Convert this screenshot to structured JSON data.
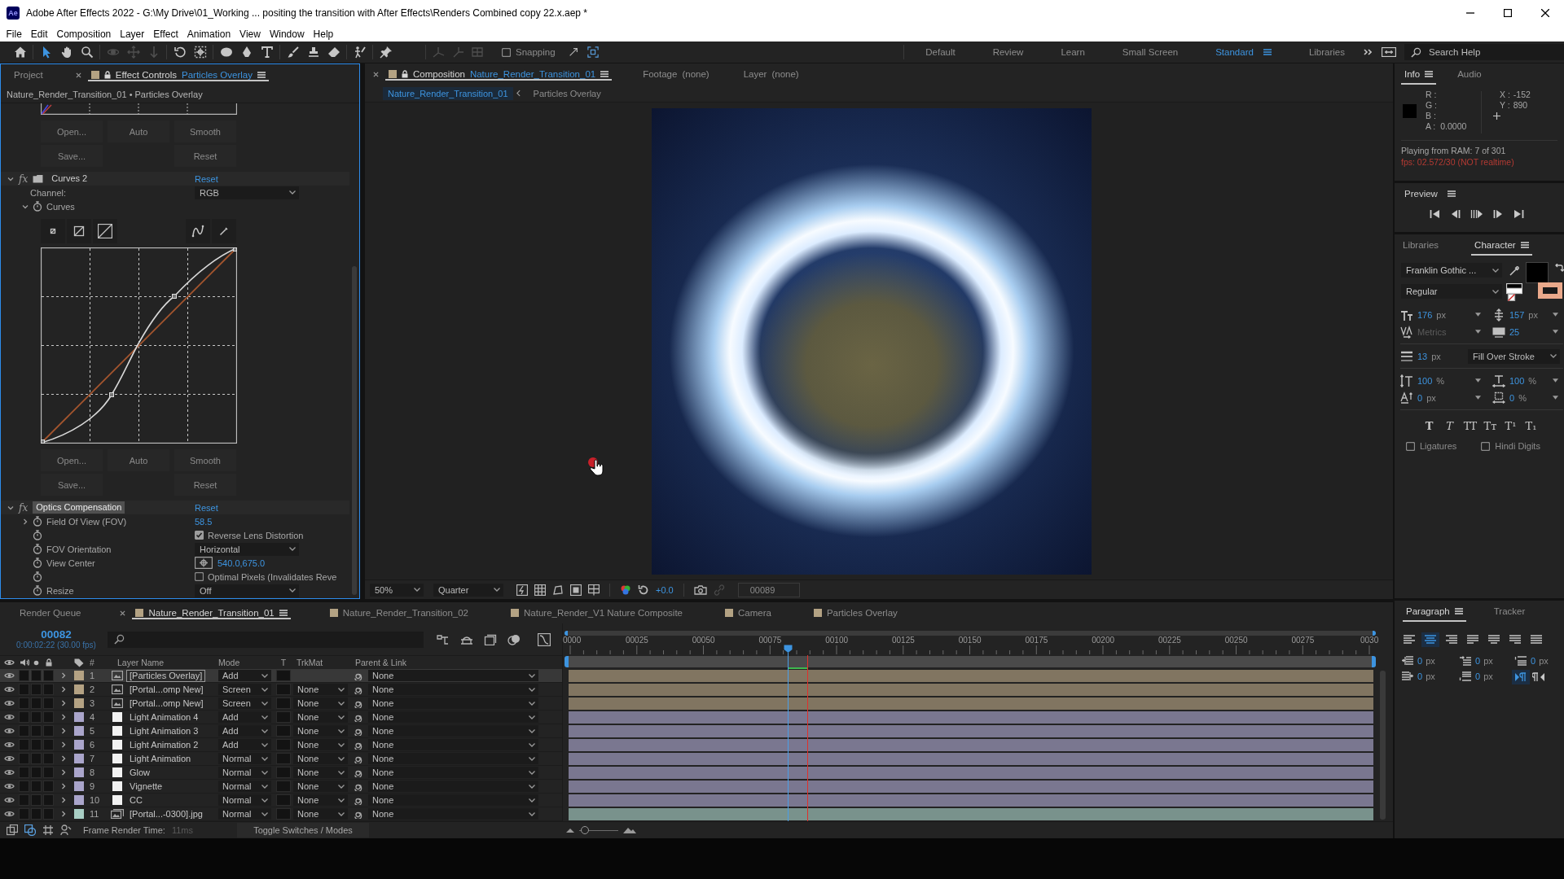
{
  "window": {
    "app_logo": "Ae",
    "title": "Adobe After Effects 2022 - G:\\My Drive\\01_Working ... positing the transition with After Effects\\Renders Combined copy 22.x.aep *"
  },
  "menu": [
    "File",
    "Edit",
    "Composition",
    "Layer",
    "Effect",
    "Animation",
    "View",
    "Window",
    "Help"
  ],
  "toolbar": {
    "tools": [
      {
        "kind": "home",
        "selected": false,
        "disabled": false
      },
      {
        "kind": "selection",
        "selected": true,
        "disabled": false
      },
      {
        "kind": "hand",
        "selected": false,
        "disabled": false
      },
      {
        "kind": "zoom",
        "selected": false,
        "disabled": false
      },
      {
        "kind": "orbit",
        "selected": false,
        "disabled": true
      },
      {
        "kind": "pan",
        "selected": false,
        "disabled": true
      },
      {
        "kind": "dolly",
        "selected": false,
        "disabled": true
      },
      {
        "kind": "rotate",
        "selected": false,
        "disabled": false
      },
      {
        "kind": "anchor",
        "selected": false,
        "disabled": false
      },
      {
        "kind": "ellipse",
        "selected": false,
        "disabled": false
      },
      {
        "kind": "pen",
        "selected": false,
        "disabled": false
      },
      {
        "kind": "type",
        "selected": false,
        "disabled": false
      },
      {
        "kind": "brush",
        "selected": false,
        "disabled": false
      },
      {
        "kind": "stamp",
        "selected": false,
        "disabled": false
      },
      {
        "kind": "eraser",
        "selected": false,
        "disabled": false
      },
      {
        "kind": "roto",
        "selected": false,
        "disabled": false
      },
      {
        "kind": "pin",
        "selected": false,
        "disabled": false
      }
    ],
    "axis_modes": [
      {
        "kind": "local",
        "disabled": true
      },
      {
        "kind": "world",
        "disabled": true
      },
      {
        "kind": "view",
        "disabled": true
      }
    ],
    "snapping": {
      "label": "Snapping",
      "checked": false
    },
    "workspaces": [
      {
        "label": "Default",
        "selected": false
      },
      {
        "label": "Review",
        "selected": false
      },
      {
        "label": "Learn",
        "selected": false
      },
      {
        "label": "Small Screen",
        "selected": false
      },
      {
        "label": "Standard",
        "selected": true
      },
      {
        "label": "Libraries",
        "selected": false
      }
    ],
    "search": {
      "placeholder": "Search Help"
    }
  },
  "effect_controls": {
    "tabs": [
      {
        "label": "Project",
        "selected": false
      },
      {
        "label": "Effect Controls",
        "subject": "Particles Overlay",
        "selected": true
      }
    ],
    "subtitle": "Nature_Render_Transition_01 • Particles Overlay",
    "previous_effect_buttons": {
      "top": [
        "Open...",
        "Auto",
        "Smooth"
      ],
      "bottom": [
        "Save...",
        "Reset"
      ]
    },
    "effects": [
      {
        "kind": "curves",
        "switch_label": "fx",
        "name": "Curves 2",
        "selected": false,
        "expanded": true,
        "reset": "Reset",
        "channel_label": "Channel:",
        "channel": "RGB",
        "property": "Curves",
        "property_expanded": true,
        "buttons": {
          "top": [
            "Open...",
            "Auto",
            "Smooth"
          ],
          "bottom": [
            "Save...",
            "Reset"
          ]
        }
      },
      {
        "kind": "optics",
        "switch_label": "fx",
        "name": "Optics Compensation",
        "selected": true,
        "expanded": true,
        "reset": "Reset",
        "properties": [
          {
            "kind": "value",
            "label": "Field Of View (FOV)",
            "value": "58.5",
            "expanded": false
          },
          {
            "kind": "checkbox",
            "label": "Reverse Lens Distortion",
            "checked": true
          },
          {
            "kind": "dropdown",
            "label": "FOV Orientation",
            "value": "Horizontal"
          },
          {
            "kind": "point",
            "label": "View Center",
            "value": "540.0,675.0"
          },
          {
            "kind": "checkbox",
            "label": "Optimal Pixels (Invalidates Reve",
            "checked": false
          },
          {
            "kind": "dropdown",
            "label": "Resize",
            "value": "Off"
          }
        ]
      }
    ]
  },
  "composition": {
    "tabs": [
      {
        "label": "Composition",
        "subject": "Nature_Render_Transition_01",
        "selected": true
      },
      {
        "label": "Footage",
        "subject": "(none)",
        "selected": false
      },
      {
        "label": "Layer",
        "subject": "(none)",
        "selected": false
      }
    ],
    "breadcrumbs": [
      {
        "label": "Nature_Render_Transition_01",
        "selected": true
      },
      {
        "label": "Particles Overlay",
        "selected": false
      }
    ],
    "viewer": {
      "magnification": "50%",
      "resolution": "Quarter",
      "exposure": "+0.0",
      "current_frame": "00089"
    }
  },
  "info": {
    "tabs": [
      {
        "label": "Info",
        "selected": true
      },
      {
        "label": "Audio",
        "selected": false
      }
    ],
    "channels": [
      "R :",
      "G :",
      "B :"
    ],
    "alpha": {
      "label": "A :",
      "value": "0.0000"
    },
    "position": [
      {
        "label": "X :",
        "value": "-152"
      },
      {
        "label": "Y :",
        "value": "890"
      }
    ],
    "status": "Playing from RAM: 7 of 301",
    "warning": "fps: 02.572/30 (NOT realtime)"
  },
  "preview": {
    "title": "Preview"
  },
  "character": {
    "tabs": [
      {
        "label": "Libraries",
        "selected": false
      },
      {
        "label": "Character",
        "selected": true
      }
    ],
    "font_family": "Franklin Gothic ...",
    "font_style": "Regular",
    "swatches": [
      {
        "kind": "fill",
        "color": "#000000"
      },
      {
        "kind": "stroke",
        "color": "#eaa98b"
      }
    ],
    "metrics": [
      {
        "kind": "font-size",
        "value": "176",
        "unit": "px",
        "disabled": false
      },
      {
        "kind": "leading",
        "value": "157",
        "unit": "px",
        "disabled": false
      },
      {
        "kind": "kerning",
        "value": "Metrics",
        "disabled": true
      },
      {
        "kind": "tracking",
        "value": "25",
        "disabled": false
      },
      {
        "kind": "stroke-width",
        "value": "13",
        "unit": "px",
        "disabled": false
      },
      {
        "kind": "stroke-order",
        "value": "Fill Over Stroke",
        "disabled": false
      },
      {
        "kind": "vertical-scale",
        "value": "100",
        "unit": "%",
        "disabled": false
      },
      {
        "kind": "horizontal-scale",
        "value": "100",
        "unit": "%",
        "disabled": false
      },
      {
        "kind": "baseline-shift",
        "value": "0",
        "unit": "px",
        "disabled": false
      },
      {
        "kind": "tsume",
        "value": "0",
        "unit": "%",
        "disabled": false
      }
    ],
    "type_styles": [
      {
        "kind": "bold",
        "label": "T"
      },
      {
        "kind": "italic",
        "label": "T"
      },
      {
        "kind": "caps",
        "label": "TT"
      },
      {
        "kind": "smallcaps",
        "label": "Tᴛ"
      },
      {
        "kind": "superscript",
        "label": "T¹"
      },
      {
        "kind": "subscript",
        "label": "T₁"
      }
    ],
    "options": [
      {
        "label": "Ligatures",
        "checked": false
      },
      {
        "label": "Hindi Digits",
        "checked": false
      }
    ]
  },
  "paragraph": {
    "tabs": [
      {
        "label": "Paragraph",
        "selected": true
      },
      {
        "label": "Tracker",
        "selected": false
      }
    ],
    "alignment": [
      {
        "kind": "left",
        "selected": false
      },
      {
        "kind": "center",
        "selected": true
      },
      {
        "kind": "right",
        "selected": false
      },
      {
        "kind": "justify-left",
        "selected": false
      },
      {
        "kind": "justify-center",
        "selected": false
      },
      {
        "kind": "justify-right",
        "selected": false
      },
      {
        "kind": "justify-all",
        "selected": false
      }
    ],
    "spacing": [
      {
        "kind": "indent-left",
        "value": "0",
        "unit": "px"
      },
      {
        "kind": "indent-first-line",
        "value": "0",
        "unit": "px"
      },
      {
        "kind": "space-before",
        "value": "0",
        "unit": "px"
      },
      {
        "kind": "indent-right",
        "value": "0",
        "unit": "px"
      },
      {
        "kind": "space-after",
        "value": "0",
        "unit": "px"
      }
    ],
    "direction": [
      {
        "kind": "left-to-right",
        "selected": true
      },
      {
        "kind": "right-to-left",
        "selected": false
      }
    ]
  },
  "timeline": {
    "tabs": [
      {
        "kind": "queue",
        "label": "Render Queue",
        "selected": false
      },
      {
        "kind": "comp",
        "label": "Nature_Render_Transition_01",
        "selected": true
      },
      {
        "kind": "comp",
        "label": "Nature_Render_Transition_02",
        "selected": false
      },
      {
        "kind": "comp",
        "label": "Nature_Render_V1 Nature Composite",
        "selected": false
      },
      {
        "kind": "comp",
        "label": "Camera",
        "selected": false
      },
      {
        "kind": "comp",
        "label": "Particles Overlay",
        "selected": false
      }
    ],
    "timecode": "00082",
    "timecode_detail": "0:00:02:22 (30.00 fps)",
    "columns": [
      "#",
      "Layer Name",
      "Mode",
      "T",
      "TrkMat",
      "Parent & Link"
    ],
    "layers": [
      {
        "number": "1",
        "name": "[Particles Overlay]",
        "kind": "precomp",
        "color": "#b4a283",
        "mode": "Add",
        "parent": "None",
        "visible": true,
        "expanded": false,
        "selected": true
      },
      {
        "number": "2",
        "name": "[Portal...omp New]",
        "kind": "precomp",
        "color": "#b4a283",
        "mode": "Screen",
        "trkmat": "None",
        "parent": "None",
        "visible": true,
        "expanded": false,
        "selected": false
      },
      {
        "number": "3",
        "name": "[Portal...omp New]",
        "kind": "precomp",
        "color": "#b4a283",
        "mode": "Screen",
        "trkmat": "None",
        "parent": "None",
        "visible": true,
        "expanded": false,
        "selected": false
      },
      {
        "number": "4",
        "name": "Light Animation 4",
        "kind": "solid",
        "color": "#aaa5cb",
        "mode": "Add",
        "trkmat": "None",
        "parent": "None",
        "visible": true,
        "expanded": false,
        "selected": false
      },
      {
        "number": "5",
        "name": "Light Animation 3",
        "kind": "solid",
        "color": "#aaa5cb",
        "mode": "Add",
        "trkmat": "None",
        "parent": "None",
        "visible": true,
        "expanded": false,
        "selected": false
      },
      {
        "number": "6",
        "name": "Light Animation 2",
        "kind": "solid",
        "color": "#aaa5cb",
        "mode": "Add",
        "trkmat": "None",
        "parent": "None",
        "visible": true,
        "expanded": false,
        "selected": false
      },
      {
        "number": "7",
        "name": "Light Animation",
        "kind": "solid",
        "color": "#aaa5cb",
        "mode": "Normal",
        "trkmat": "None",
        "parent": "None",
        "visible": true,
        "expanded": false,
        "selected": false
      },
      {
        "number": "8",
        "name": "Glow",
        "kind": "solid",
        "color": "#aaa5cb",
        "mode": "Normal",
        "trkmat": "None",
        "parent": "None",
        "visible": true,
        "expanded": false,
        "selected": false
      },
      {
        "number": "9",
        "name": "Vignette",
        "kind": "solid",
        "color": "#aaa5cb",
        "mode": "Normal",
        "trkmat": "None",
        "parent": "None",
        "visible": true,
        "expanded": false,
        "selected": false
      },
      {
        "number": "10",
        "name": "CC",
        "kind": "solid",
        "color": "#aaa5cb",
        "mode": "Normal",
        "trkmat": "None",
        "parent": "None",
        "visible": true,
        "expanded": false,
        "selected": false
      },
      {
        "number": "11",
        "name": "[Portal...-0300].jpg",
        "kind": "still",
        "color": "#a8cec4",
        "mode": "Normal",
        "trkmat": "None",
        "parent": "None",
        "visible": true,
        "expanded": false,
        "selected": false
      }
    ],
    "ruler_labels": [
      "0000",
      "00025",
      "00050",
      "00075",
      "00100",
      "00125",
      "00150",
      "00175",
      "00200",
      "00225",
      "00250",
      "00275",
      "0030"
    ],
    "playhead": {
      "level": 0.273
    },
    "marker": {
      "level": 0.297
    },
    "zoom_slider": {
      "level": 0.15
    },
    "render_time": {
      "label": "Frame Render Time:",
      "value": "11ms"
    },
    "toggle": "Toggle Switches / Modes"
  }
}
